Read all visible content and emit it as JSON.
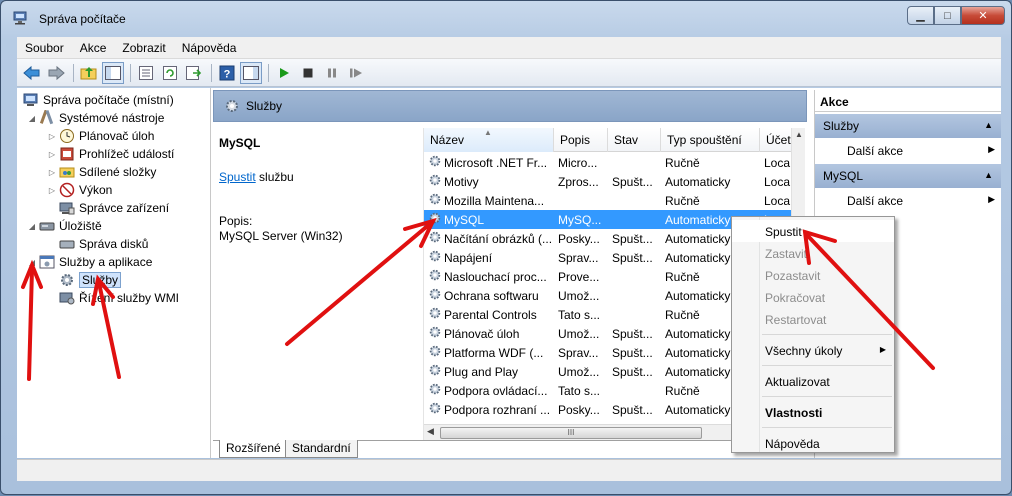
{
  "window": {
    "title": "Správa počítače",
    "min_label": "▭",
    "max_label": "□",
    "close_label": "✕"
  },
  "menu": {
    "items": [
      "Soubor",
      "Akce",
      "Zobrazit",
      "Nápověda"
    ]
  },
  "tree": {
    "items": [
      {
        "label": "Správa počítače (místní)",
        "icon": "computer-icon"
      },
      {
        "label": "Systémové nástroje",
        "icon": "tools-icon"
      },
      {
        "label": "Plánovač úloh",
        "icon": "clock-icon"
      },
      {
        "label": "Prohlížeč událostí",
        "icon": "event-viewer-icon"
      },
      {
        "label": "Sdílené složky",
        "icon": "shared-folder-icon"
      },
      {
        "label": "Výkon",
        "icon": "performance-icon"
      },
      {
        "label": "Správce zařízení",
        "icon": "device-manager-icon"
      },
      {
        "label": "Úložiště",
        "icon": "storage-icon"
      },
      {
        "label": "Správa disků",
        "icon": "disk-icon"
      },
      {
        "label": "Služby a aplikace",
        "icon": "services-apps-icon"
      },
      {
        "label": "Služby",
        "icon": "services-icon"
      },
      {
        "label": "Řízení služby WMI",
        "icon": "wmi-icon"
      }
    ]
  },
  "center": {
    "title": "Služby",
    "service_name": "MySQL",
    "start_link": "Spustit",
    "start_link_suffix": " službu",
    "desc_label": "Popis:",
    "desc_text": "MySQL Server (Win32)"
  },
  "list": {
    "columns": [
      "Název",
      "Popis",
      "Stav",
      "Typ spouštění",
      "Účet"
    ],
    "rows": [
      {
        "name": "Microsoft .NET Fr...",
        "desc": "Micro...",
        "state": "",
        "start": "Ručně",
        "acc": "Loca"
      },
      {
        "name": "Motivy",
        "desc": "Zpros...",
        "state": "Spušt...",
        "start": "Automaticky",
        "acc": "Loca"
      },
      {
        "name": "Mozilla Maintena...",
        "desc": "",
        "state": "",
        "start": "Ručně",
        "acc": "Loca"
      },
      {
        "name": "MySQL",
        "desc": "MySQ...",
        "state": "",
        "start": "Automaticky",
        "acc": "Loca"
      },
      {
        "name": "Načítání obrázků (...",
        "desc": "Posky...",
        "state": "Spušt...",
        "start": "Automaticky",
        "acc": ""
      },
      {
        "name": "Napájení",
        "desc": "Sprav...",
        "state": "Spušt...",
        "start": "Automaticky",
        "acc": ""
      },
      {
        "name": "Naslouchací proc...",
        "desc": "Prove...",
        "state": "",
        "start": "Ručně",
        "acc": ""
      },
      {
        "name": "Ochrana softwaru",
        "desc": "Umož...",
        "state": "",
        "start": "Automaticky",
        "acc": ""
      },
      {
        "name": "Parental Controls",
        "desc": "Tato s...",
        "state": "",
        "start": "Ručně",
        "acc": ""
      },
      {
        "name": "Plánovač úloh",
        "desc": "Umož...",
        "state": "Spušt...",
        "start": "Automaticky",
        "acc": ""
      },
      {
        "name": "Platforma WDF (...",
        "desc": "Sprav...",
        "state": "Spušt...",
        "start": "Automaticky",
        "acc": ""
      },
      {
        "name": "Plug and Play",
        "desc": "Umož...",
        "state": "Spušt...",
        "start": "Automaticky",
        "acc": ""
      },
      {
        "name": "Podpora ovládací...",
        "desc": "Tato s...",
        "state": "",
        "start": "Ručně",
        "acc": ""
      },
      {
        "name": "Podpora rozhraní ...",
        "desc": "Posky...",
        "state": "Spušt...",
        "start": "Automaticky",
        "acc": ""
      }
    ],
    "selected_index": 3,
    "hscroll_grip": "III"
  },
  "tabs": [
    "Rozšířené",
    "Standardní"
  ],
  "actions": {
    "header": "Akce",
    "groups": [
      {
        "title": "Služby",
        "items": [
          "Další akce"
        ]
      },
      {
        "title": "MySQL",
        "items": [
          "Další akce"
        ]
      }
    ]
  },
  "context_menu": {
    "items": [
      {
        "label": "Spustit",
        "enabled": true,
        "bold": false
      },
      {
        "label": "Zastavit",
        "enabled": false,
        "bold": false
      },
      {
        "label": "Pozastavit",
        "enabled": false,
        "bold": false
      },
      {
        "label": "Pokračovat",
        "enabled": false,
        "bold": false
      },
      {
        "label": "Restartovat",
        "enabled": false,
        "bold": false
      },
      {
        "label": "Všechny úkoly",
        "enabled": true,
        "bold": false,
        "submenu": true
      },
      {
        "label": "Aktualizovat",
        "enabled": true,
        "bold": false
      },
      {
        "label": "Vlastnosti",
        "enabled": true,
        "bold": true
      },
      {
        "label": "Nápověda",
        "enabled": true,
        "bold": false
      }
    ]
  },
  "colors": {
    "selection": "#3399ff",
    "annotation_arrow": "#e01010",
    "link": "#0066cc"
  }
}
